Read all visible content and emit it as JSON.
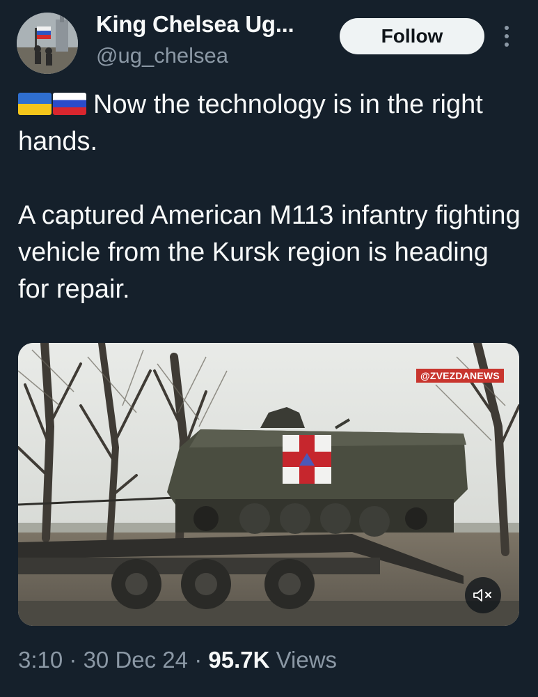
{
  "author": {
    "display_name": "King Chelsea Ug...",
    "handle": "@ug_chelsea",
    "avatar_icon": "avatar-photo"
  },
  "actions": {
    "follow_label": "Follow",
    "more_icon": "more-vertical-icon"
  },
  "tweet": {
    "flags": [
      "ukraine-flag",
      "russia-flag"
    ],
    "line1": "Now the technology is in the right hands.",
    "line2": "A captured American M113 infantry fighting vehicle from the Kursk region is heading for repair."
  },
  "media": {
    "watermark": "@ZVEZDANEWS",
    "mute_icon": "volume-muted-icon"
  },
  "meta": {
    "time": "3:10",
    "separator": "·",
    "date": "30 Dec 24",
    "views_count": "95.7K",
    "views_label": "Views"
  },
  "colors": {
    "background": "#15202b",
    "text_primary": "#f7f9f9",
    "text_secondary": "#8b98a5",
    "follow_bg": "#eff3f4",
    "watermark_bg": "#c8352e"
  }
}
